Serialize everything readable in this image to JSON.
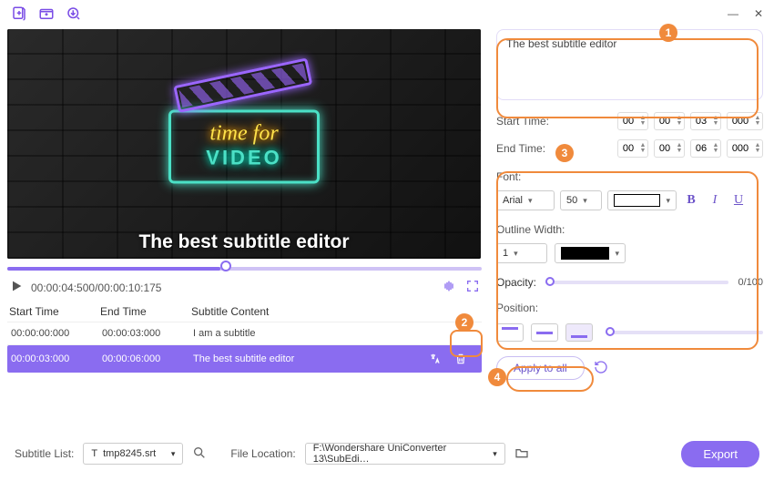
{
  "titlebar": {
    "min": "—",
    "close": "✕"
  },
  "video": {
    "neon_line1": "time for",
    "neon_line2": "VIDEO",
    "subtitle_overlay": "The best subtitle editor"
  },
  "playback": {
    "time": "00:00:04:500/00:00:10:175"
  },
  "table": {
    "head": {
      "start": "Start Time",
      "end": "End Time",
      "content": "Subtitle Content"
    },
    "rows": [
      {
        "start": "00:00:00:000",
        "end": "00:00:03:000",
        "content": "I am a subtitle"
      },
      {
        "start": "00:00:03:000",
        "end": "00:00:06:000",
        "content": "The best subtitle editor"
      }
    ]
  },
  "panel": {
    "text": "The best subtitle editor",
    "start_label": "Start Time:",
    "end_label": "End Time:",
    "start": [
      "00",
      "00",
      "03",
      "000"
    ],
    "end": [
      "00",
      "00",
      "06",
      "000"
    ],
    "font_label": "Font:",
    "font_name": "Arial",
    "font_size": "50",
    "outline_label": "Outline Width:",
    "outline_width": "1",
    "opacity_label": "Opacity:",
    "opacity_value": "0/100",
    "position_label": "Position:",
    "apply_label": "Apply to all"
  },
  "footer": {
    "list_label": "Subtitle List:",
    "list_value": "tmp8245.srt",
    "loc_label": "File Location:",
    "loc_value": "F:\\Wondershare UniConverter 13\\SubEdi…",
    "export": "Export"
  },
  "callouts": {
    "n1": "1",
    "n2": "2",
    "n3": "3",
    "n4": "4"
  }
}
